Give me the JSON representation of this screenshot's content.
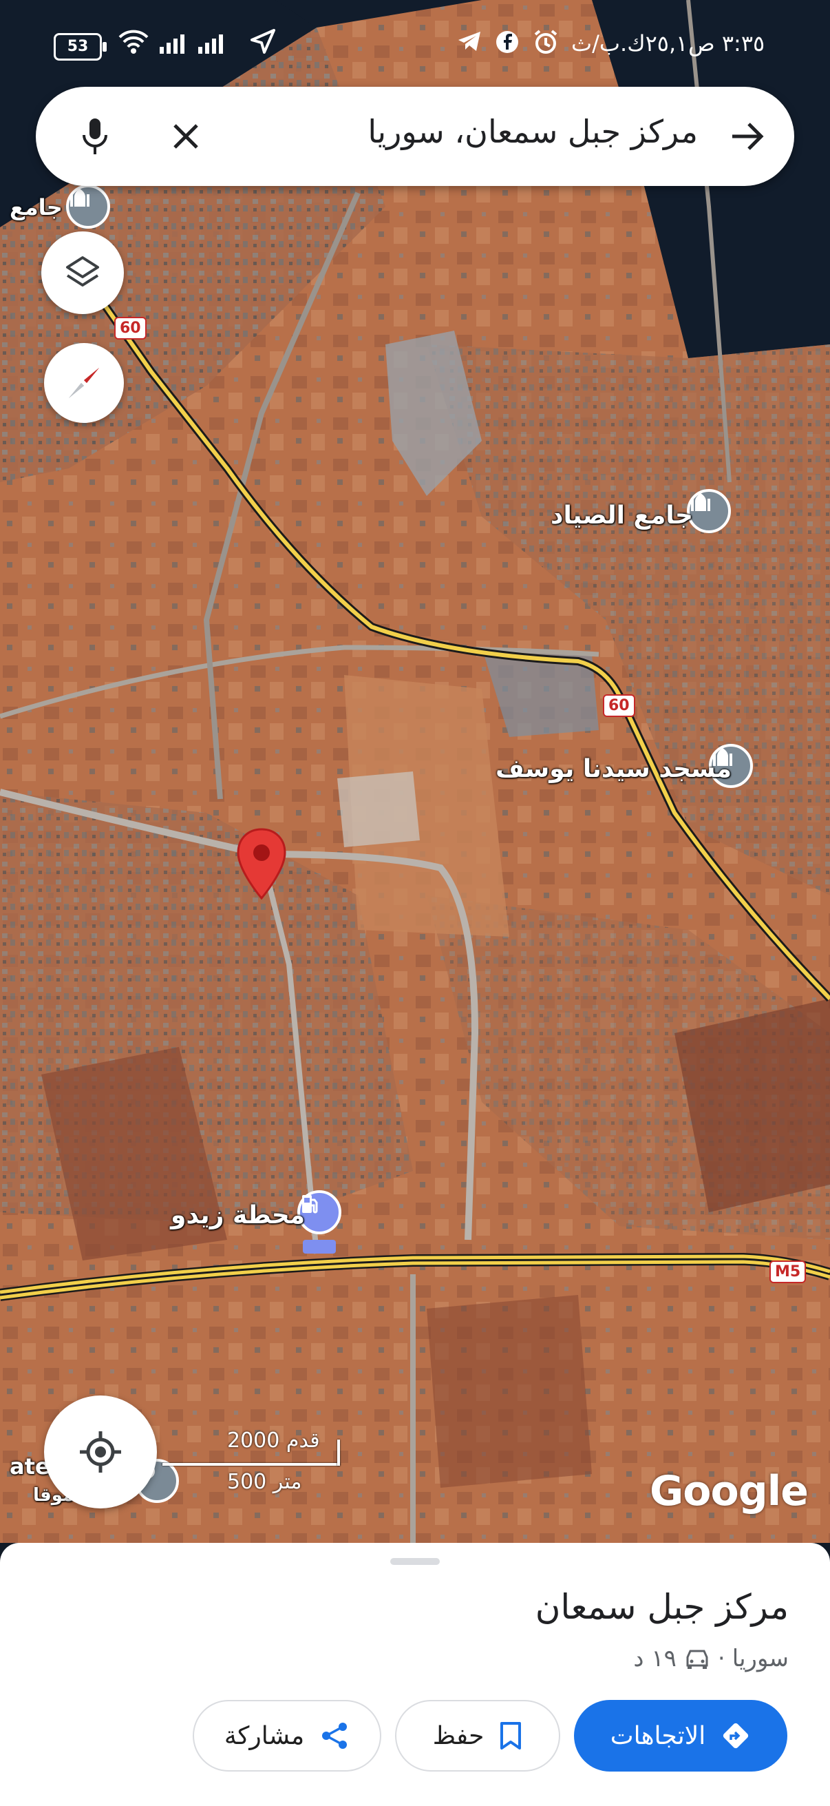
{
  "status_bar": {
    "time": "٣:٣٥ ص",
    "speed": "٢٥,١ك.ب/ث",
    "battery": "53",
    "icons": [
      "telegram-icon",
      "facebook-icon",
      "alarm-icon",
      "location-arrow-icon",
      "signal-icon",
      "wifi-icon",
      "battery-icon"
    ]
  },
  "search": {
    "query": "مركز جبل سمعان، سوريا",
    "back_icon": "arrow-right-icon",
    "clear_icon": "close-icon",
    "voice_icon": "mic-icon"
  },
  "map": {
    "labels": {
      "mosque1": "جامع الصياد",
      "mosque2": "مسجد سيدنا يوسف",
      "station": "محطة زيدو",
      "edge_top_left": "جامع",
      "edge_bottom_left": "ate",
      "edge_bottom_left_arabic": "موقا"
    },
    "road_shields": [
      "60",
      "60",
      "M5"
    ],
    "scale_feet": "2000 قدم",
    "scale_meters": "500 متر",
    "attribution": "Google",
    "colors": {
      "road": "#f2d04b",
      "pin": "#e53935",
      "terrain": "#b9714a",
      "poi": "#7b8a96"
    }
  },
  "sheet": {
    "title": "مركز جبل سمعان",
    "subtitle_country": "سوريا",
    "subtitle_sep": "·",
    "drive_time": "١٩ د",
    "buttons": {
      "directions": "الاتجاهات",
      "save": "حفظ",
      "share": "مشاركة"
    },
    "accent": "#1a73e8"
  }
}
